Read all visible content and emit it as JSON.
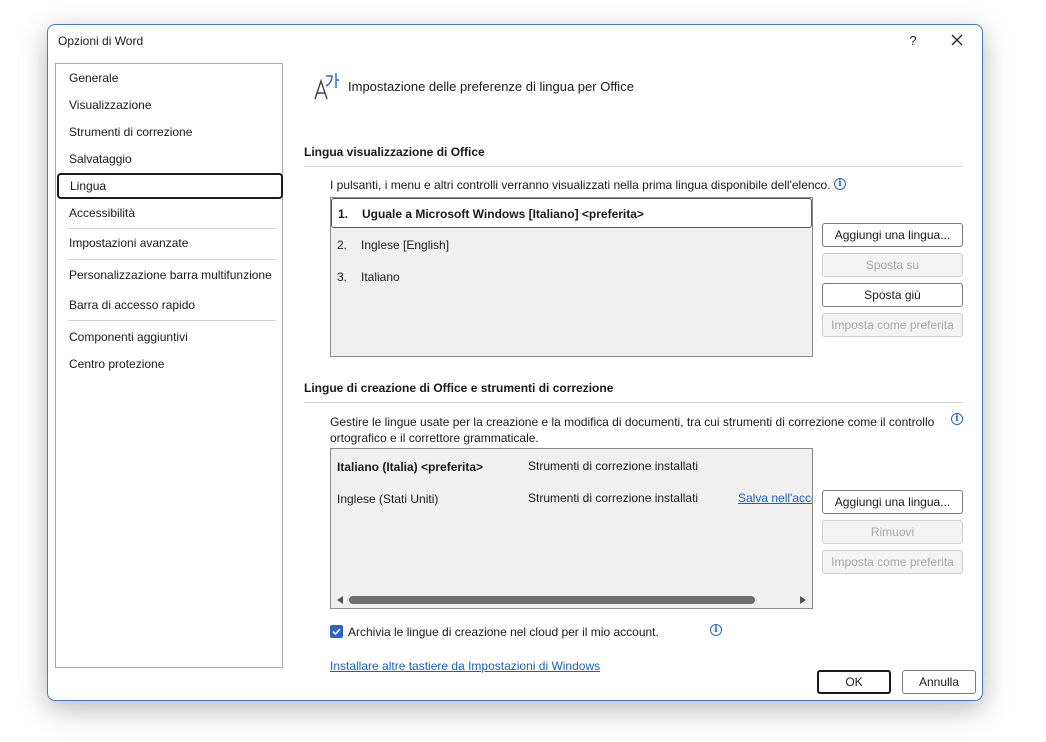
{
  "window": {
    "title": "Opzioni di Word",
    "help_label": "?",
    "close_icon": "close-icon"
  },
  "nav": {
    "items": [
      {
        "label": "Generale"
      },
      {
        "label": "Visualizzazione"
      },
      {
        "label": "Strumenti di correzione"
      },
      {
        "label": "Salvataggio"
      },
      {
        "label": "Lingua",
        "selected": true
      },
      {
        "label": "Accessibilità"
      },
      {
        "label": "Impostazioni avanzate"
      },
      {
        "label": "Personalizzazione barra multifunzione"
      },
      {
        "label": "Barra di accesso rapido"
      },
      {
        "label": "Componenti aggiuntivi"
      },
      {
        "label": "Centro protezione"
      }
    ]
  },
  "header": {
    "title": "Impostazione delle preferenze di lingua per Office",
    "icon": "language-icon"
  },
  "display_section": {
    "title": "Lingua visualizzazione di Office",
    "description": "I pulsanti, i menu e altri controlli verranno visualizzati nella prima lingua disponibile dell'elenco.",
    "languages": [
      {
        "num": "1.",
        "name": "Uguale a Microsoft Windows [Italiano] <preferita>"
      },
      {
        "num": "2.",
        "name": "Inglese [English]"
      },
      {
        "num": "3.",
        "name": "Italiano"
      }
    ],
    "buttons": {
      "add": "Aggiungi una lingua...",
      "move_up": "Sposta su",
      "move_down": "Sposta giù",
      "set_preferred": "Imposta come preferita"
    }
  },
  "authoring_section": {
    "title": "Lingue di creazione di Office e strumenti di correzione",
    "description_line1": "Gestire le lingue usate per la creazione e la modifica di documenti, tra cui strumenti di correzione come il controllo",
    "description_line2": "ortografico e il correttore grammaticale.",
    "languages": [
      {
        "name": "Italiano (Italia) <preferita>",
        "status": "Strumenti di correzione installati",
        "link": ""
      },
      {
        "name": "Inglese (Stati Uniti)",
        "status": "Strumenti di correzione installati",
        "link": "Salva nell'account"
      }
    ],
    "buttons": {
      "add": "Aggiungi una lingua...",
      "remove": "Rimuovi",
      "set_preferred": "Imposta come preferita"
    }
  },
  "cloud_checkbox": {
    "label": "Archivia le lingue di creazione nel cloud per il mio account.",
    "checked": true
  },
  "keyboards_link": "Installare altre tastiere da Impostazioni di Windows",
  "footer": {
    "ok": "OK",
    "cancel": "Annulla"
  },
  "colors": {
    "accent": "#2b66c4",
    "link": "#1f5fb8",
    "window_border": "#4a78c2"
  }
}
